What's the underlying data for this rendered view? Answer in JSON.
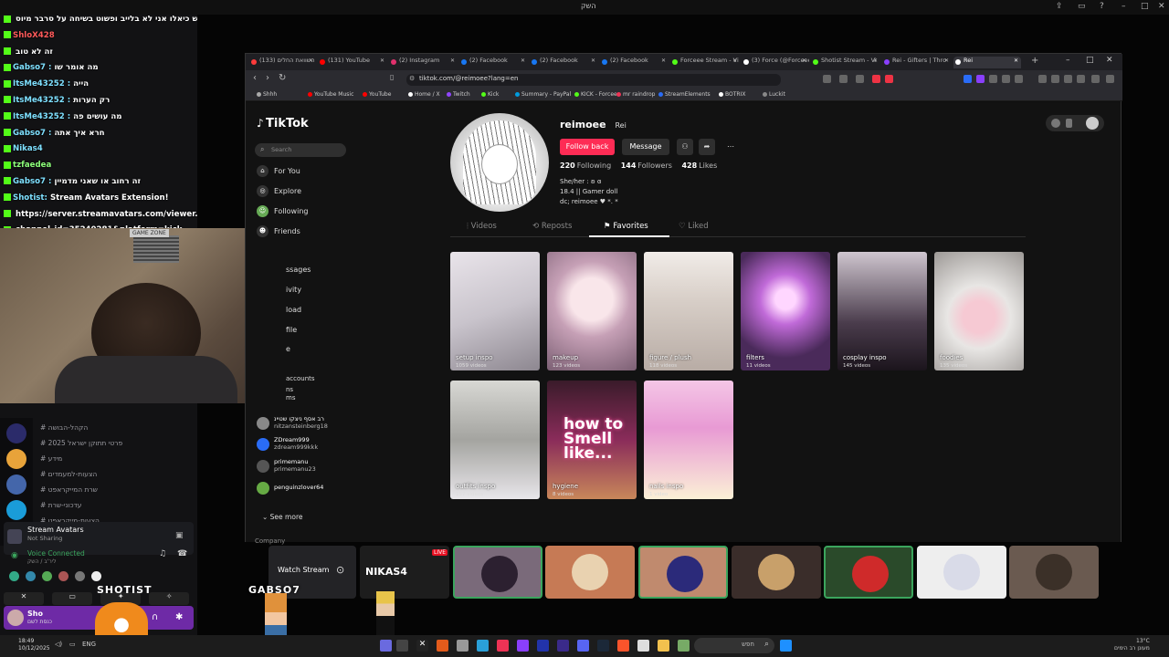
{
  "topbar": {
    "title": "השק"
  },
  "chat": {
    "lines": [
      {
        "user": "",
        "text": "מרגיש כיאלו אני לא בלייב ופשוט בשיחה על סרבר מיוס",
        "cls": ""
      },
      {
        "user": "ShloX428",
        "text": "",
        "cls": "red"
      },
      {
        "user": "",
        "text": "זה לא טוב",
        "cls": ""
      },
      {
        "user": "Gabso7 :",
        "text": "מה אומר שו",
        "cls": ""
      },
      {
        "user": "ItsMe43252 :",
        "text": "הייה",
        "cls": ""
      },
      {
        "user": "ItsMe43252 :",
        "text": "רק הערות",
        "cls": ""
      },
      {
        "user": "ItsMe43252 :",
        "text": "מה עושים פה",
        "cls": ""
      },
      {
        "user": "Gabso7 :",
        "text": "חרא איך אתה",
        "cls": ""
      },
      {
        "user": "Nikas4",
        "text": "",
        "cls": ""
      },
      {
        "user": "tzfaedea",
        "text": "",
        "cls": "green"
      },
      {
        "user": "Gabso7 :",
        "text": "זה רחוב או שאני מדמיין",
        "cls": ""
      },
      {
        "user": "Shotist:",
        "text": "Stream Avatars Extension!",
        "cls": ""
      },
      {
        "user": "",
        "text": "https://server.streamavatars.com/viewer.html?",
        "cls": ""
      },
      {
        "user": "",
        "text": "channel_id=35240281&platform=kick",
        "cls": ""
      },
      {
        "user": "Gabso7 :",
        "text": "תמסור לו שבא לי את המיונז שוט",
        "cls": ""
      }
    ]
  },
  "webcam": {
    "poster": "GAME ZONE",
    "loading": "LOADING"
  },
  "discord": {
    "channels": [
      "הקהל-הבושה",
      "פרטי תתוקן ישראל 2025",
      "מידע",
      "הצעות-למעמדים",
      "שרת המייקראפט",
      "עדכוני-שרת",
      "הצעות-מייקראפט"
    ],
    "stream_avatars": {
      "title": "Stream Avatars",
      "status": "Not Sharing"
    },
    "voice": {
      "status": "Voice Connected",
      "sub": "ליר'ב / השק"
    },
    "buttons": [
      "",
      "",
      "",
      ""
    ],
    "user": {
      "name": "Sho",
      "status": "כנסת לשם"
    }
  },
  "overlay": {
    "shotist": "SHOTIST",
    "gabso": "GABSO7",
    "nikas": "NIKAS4"
  },
  "browser": {
    "tabs": [
      {
        "label": "השוואת החלים (133)",
        "color": "#ff3b3b"
      },
      {
        "label": "(131) YouTube",
        "color": "#ff0000"
      },
      {
        "label": "(2) Instagram",
        "color": "#e1306c"
      },
      {
        "label": "(2) Facebook",
        "color": "#1877f2"
      },
      {
        "label": "(2) Facebook",
        "color": "#1877f2"
      },
      {
        "label": "(2) Facebook",
        "color": "#1877f2"
      },
      {
        "label": "Forceee Stream - Vi",
        "color": "#53fc18"
      },
      {
        "label": "(3) Force (@Forceee",
        "color": "#ffffff"
      },
      {
        "label": "Shotist Stream - Vi",
        "color": "#53fc18"
      },
      {
        "label": "Rei - Gifters | Thro",
        "color": "#8a3ffc"
      },
      {
        "label": "Rei",
        "color": "#ffffff"
      }
    ],
    "url": "tiktok.com/@reimoee?lang=en",
    "bookmarks": [
      {
        "label": "Shhh",
        "color": "#aaa"
      },
      {
        "label": "YouTube Music",
        "color": "#ff0000"
      },
      {
        "label": "YouTube",
        "color": "#ff0000"
      },
      {
        "label": "Home / X",
        "color": "#fff"
      },
      {
        "label": "Twitch",
        "color": "#9146ff"
      },
      {
        "label": "Kick",
        "color": "#53fc18"
      },
      {
        "label": "Summary - PayPal",
        "color": "#009cde"
      },
      {
        "label": "KICK - Forceee",
        "color": "#53fc18"
      },
      {
        "label": "mr raindrop",
        "color": "#e35"
      },
      {
        "label": "StreamElements",
        "color": "#2a6cf6"
      },
      {
        "label": "BOTRIX",
        "color": "#fff"
      },
      {
        "label": "Luckit",
        "color": "#888"
      }
    ]
  },
  "tiktok": {
    "logo": "TikTok",
    "search_placeholder": "Search",
    "nav": [
      "For You",
      "Explore",
      "Following",
      "Friends"
    ],
    "nav_trunc": [
      "ssages",
      "ivity",
      "load",
      "file",
      "e"
    ],
    "following_accounts_label": "accounts",
    "following_accounts_sub": [
      "ns",
      "ms"
    ],
    "following": [
      {
        "a": "רב אסף ניצקו שטיינ",
        "b": "nitzansteinberg18"
      },
      {
        "a": "ZDream999",
        "b": "zdream999kkk"
      },
      {
        "a": "primemanu",
        "b": "primemanu23"
      },
      {
        "a": "penguinzlover64",
        "b": ""
      }
    ],
    "see_more": "See more",
    "company": "Company",
    "profile": {
      "username": "reimoee",
      "display": "Rei",
      "follow_back": "Follow back",
      "message": "Message",
      "following": "220",
      "following_label": "Following",
      "followers": "144",
      "followers_label": "Followers",
      "likes": "428",
      "likes_label": "Likes",
      "bio": [
        "She/her : ʚ ɞ",
        "18.4 || Gamer doll",
        "dc; reimoee ♥ *. *"
      ]
    },
    "content_tabs": [
      "Videos",
      "Reposts",
      "Favorites",
      "Liked"
    ],
    "collections": [
      {
        "label": "setup inspo",
        "count": "1059 videos"
      },
      {
        "label": "makeup",
        "count": "123 videos"
      },
      {
        "label": "figure / plush",
        "count": "118 videos"
      },
      {
        "label": "filters",
        "count": "11 videos"
      },
      {
        "label": "cosplay inspo",
        "count": "145 videos"
      },
      {
        "label": "foodies",
        "count": "135 videos"
      },
      {
        "label": "outfits inspo",
        "count": "157 videos"
      },
      {
        "label": "hygiene",
        "count": "8 videos"
      },
      {
        "label": "nails inspo",
        "count": "1 video"
      }
    ],
    "smell_text": "how to Smell like..."
  },
  "participants": {
    "watch_stream": "Watch Stream",
    "live": "LIVE"
  },
  "taskbar": {
    "search": "חפש",
    "clock_time": "18:49",
    "clock_date": "10/12/2025",
    "lang": "ENG",
    "weather_temp": "13°C",
    "weather_desc": "מעונן רב הימים"
  }
}
